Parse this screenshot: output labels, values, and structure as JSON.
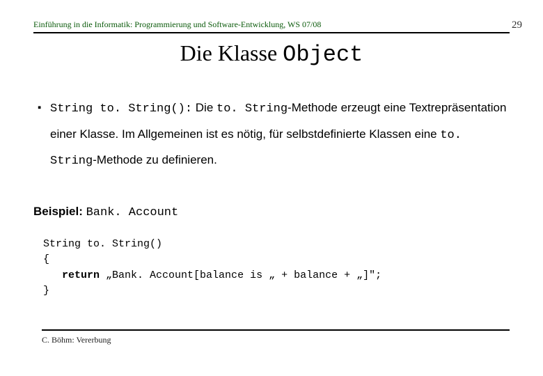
{
  "header": {
    "course": "Einführung in die Informatik: Programmierung und Software-Entwicklung, WS 07/08",
    "page_number": "29"
  },
  "title": {
    "prefix": "Die Klasse ",
    "code": "Object"
  },
  "bullet": {
    "sig": "String to. String():",
    "t1": " Die ",
    "m1": "to. String",
    "t2": "-Methode erzeugt eine Textrepräsentation einer Klasse. Im Allgemeinen ist es nötig, für selbstdefinierte Klassen eine ",
    "m2": "to. String",
    "t3": "-Methode zu definieren."
  },
  "example": {
    "label": "Beispiel:",
    "classname": "Bank. Account"
  },
  "code": {
    "l1": "String to. String()",
    "l2": "{",
    "kw": "return",
    "l3_rest": " „Bank. Account[balance is „ + balance + „]\";",
    "l4": "}"
  },
  "footer": {
    "text": "C. Böhm: Vererbung"
  }
}
